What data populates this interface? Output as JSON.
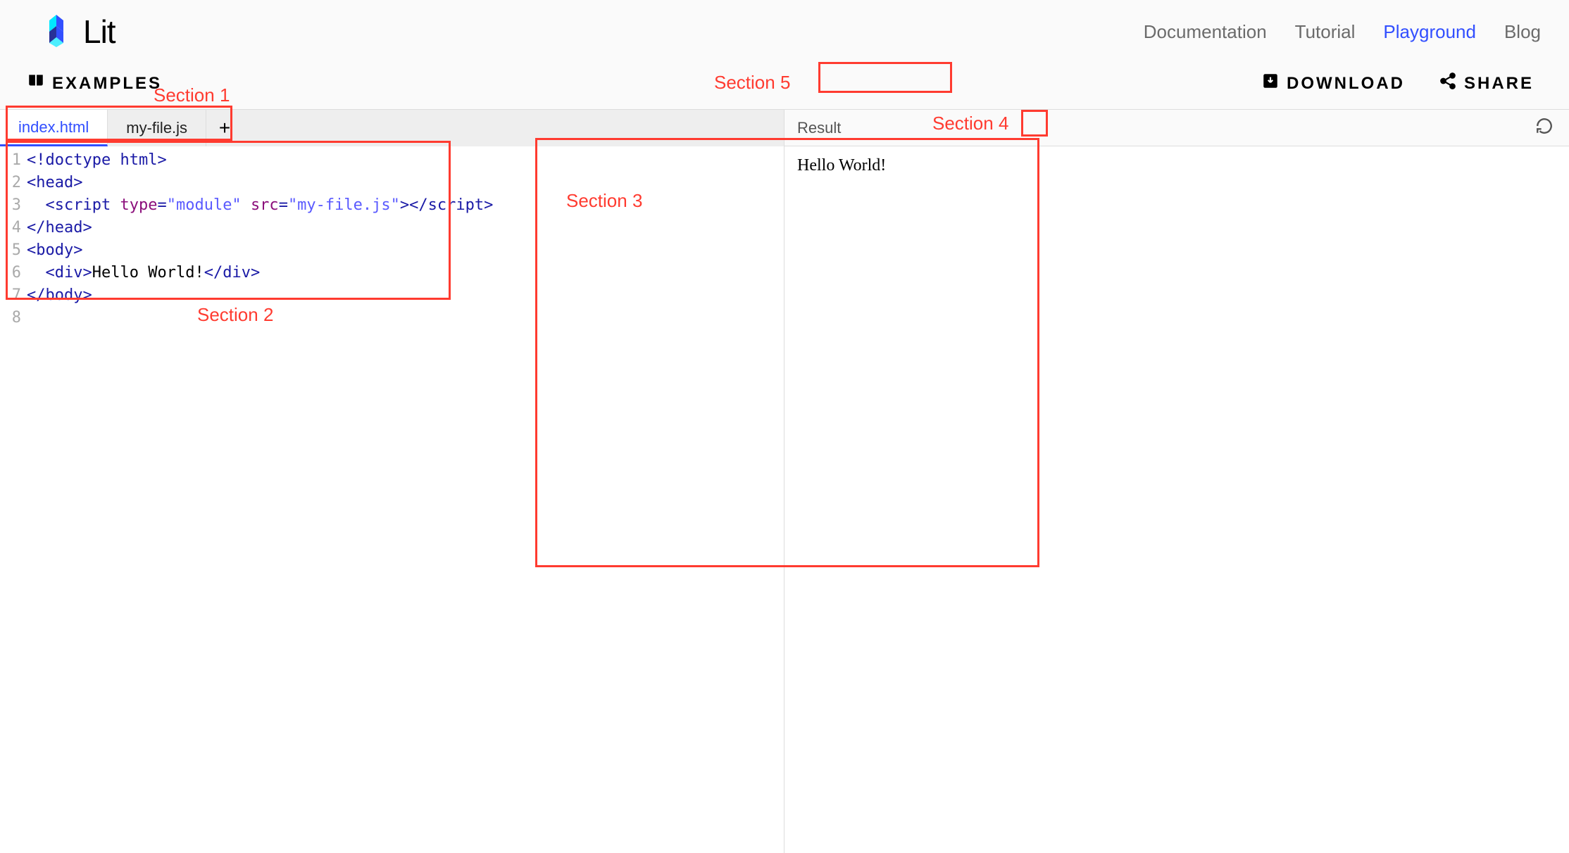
{
  "header": {
    "brand": "Lit",
    "nav": [
      {
        "label": "Documentation",
        "active": false
      },
      {
        "label": "Tutorial",
        "active": false
      },
      {
        "label": "Playground",
        "active": true
      },
      {
        "label": "Blog",
        "active": false
      }
    ]
  },
  "toolbar": {
    "examples_label": "EXAMPLES",
    "download_label": "DOWNLOAD",
    "share_label": "SHARE"
  },
  "annotations": {
    "section1": "Section 1",
    "section2": "Section 2",
    "section3": "Section 3",
    "section4": "Section 4",
    "section5": "Section 5"
  },
  "editor": {
    "tabs": [
      {
        "label": "index.html",
        "active": true
      },
      {
        "label": "my-file.js",
        "active": false
      }
    ],
    "line_numbers": [
      "1",
      "2",
      "3",
      "4",
      "5",
      "6",
      "7",
      "8"
    ],
    "code_lines": [
      {
        "tokens": [
          {
            "cls": "tok-punc",
            "t": "<!"
          },
          {
            "cls": "tok-tag",
            "t": "doctype html"
          },
          {
            "cls": "tok-punc",
            "t": ">"
          }
        ]
      },
      {
        "tokens": [
          {
            "cls": "tok-punc",
            "t": "<"
          },
          {
            "cls": "tok-tag",
            "t": "head"
          },
          {
            "cls": "tok-punc",
            "t": ">"
          }
        ]
      },
      {
        "tokens": [
          {
            "cls": "tok-text",
            "t": "  "
          },
          {
            "cls": "tok-punc",
            "t": "<"
          },
          {
            "cls": "tok-tag",
            "t": "script"
          },
          {
            "cls": "tok-text",
            "t": " "
          },
          {
            "cls": "tok-attr",
            "t": "type"
          },
          {
            "cls": "tok-punc",
            "t": "="
          },
          {
            "cls": "tok-str",
            "t": "\"module\""
          },
          {
            "cls": "tok-text",
            "t": " "
          },
          {
            "cls": "tok-attr",
            "t": "src"
          },
          {
            "cls": "tok-punc",
            "t": "="
          },
          {
            "cls": "tok-str",
            "t": "\"my-file.js\""
          },
          {
            "cls": "tok-punc",
            "t": "></"
          },
          {
            "cls": "tok-tag",
            "t": "script"
          },
          {
            "cls": "tok-punc",
            "t": ">"
          }
        ]
      },
      {
        "tokens": [
          {
            "cls": "tok-punc",
            "t": "</"
          },
          {
            "cls": "tok-tag",
            "t": "head"
          },
          {
            "cls": "tok-punc",
            "t": ">"
          }
        ]
      },
      {
        "tokens": [
          {
            "cls": "tok-punc",
            "t": "<"
          },
          {
            "cls": "tok-tag",
            "t": "body"
          },
          {
            "cls": "tok-punc",
            "t": ">"
          }
        ]
      },
      {
        "tokens": [
          {
            "cls": "tok-text",
            "t": "  "
          },
          {
            "cls": "tok-punc",
            "t": "<"
          },
          {
            "cls": "tok-tag",
            "t": "div"
          },
          {
            "cls": "tok-punc",
            "t": ">"
          },
          {
            "cls": "tok-text",
            "t": "Hello World!"
          },
          {
            "cls": "tok-punc",
            "t": "</"
          },
          {
            "cls": "tok-tag",
            "t": "div"
          },
          {
            "cls": "tok-punc",
            "t": ">"
          }
        ]
      },
      {
        "tokens": [
          {
            "cls": "tok-punc",
            "t": "</"
          },
          {
            "cls": "tok-tag",
            "t": "body"
          },
          {
            "cls": "tok-punc",
            "t": ">"
          }
        ]
      },
      {
        "tokens": []
      }
    ]
  },
  "result": {
    "header_label": "Result",
    "output_text": "Hello World!"
  }
}
